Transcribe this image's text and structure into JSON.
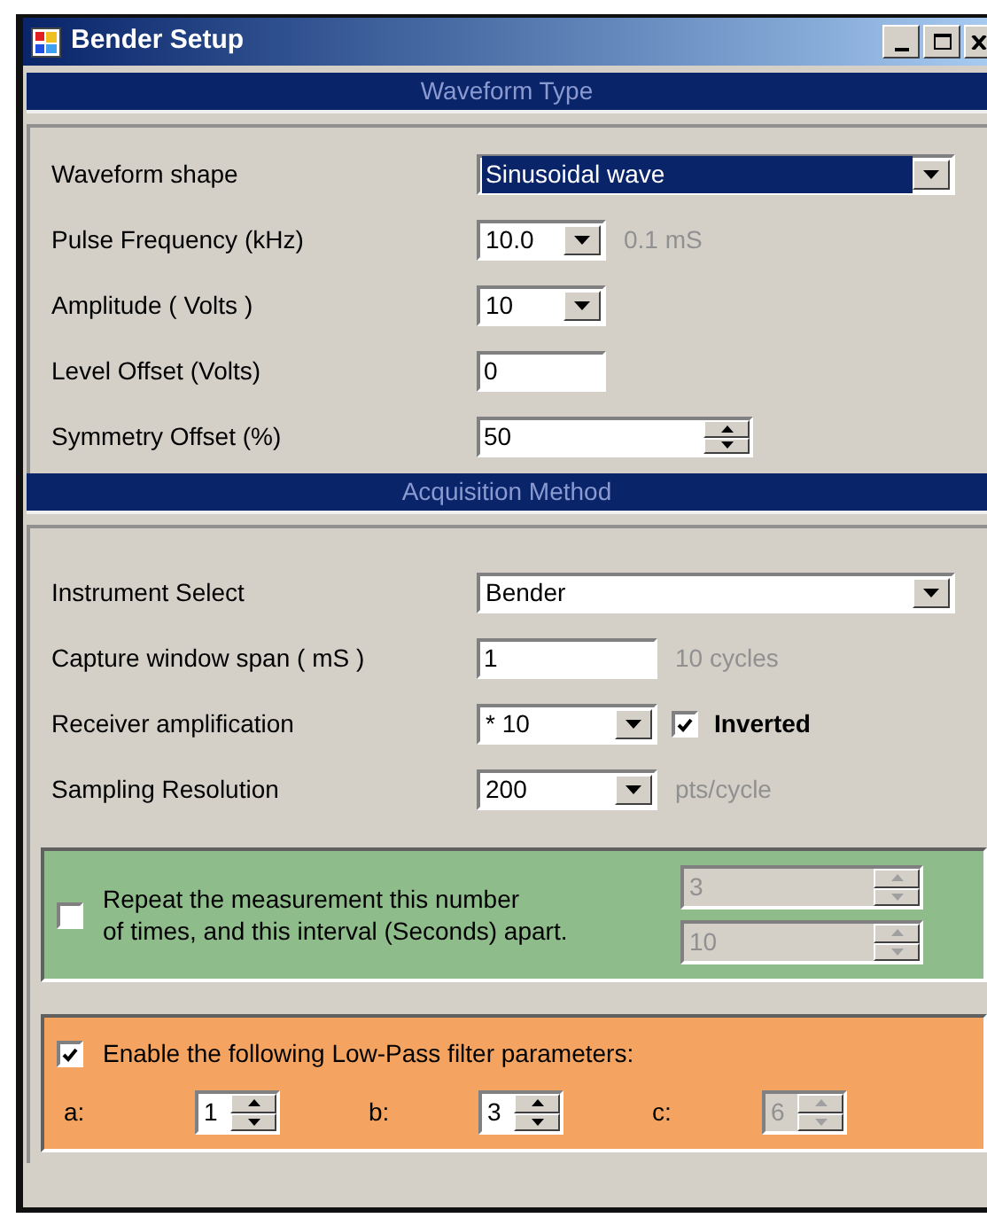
{
  "window": {
    "title": "Bender Setup"
  },
  "sections": [
    {
      "header": "Waveform Type",
      "rows": [
        {
          "label": "Waveform shape",
          "kind": "dropdown",
          "value": "Sinusoidal wave",
          "focused": true
        },
        {
          "label": "Pulse Frequency (kHz)",
          "kind": "dropdown",
          "value": "10.0",
          "focused": false,
          "note": "0.1 mS"
        },
        {
          "label": "Amplitude ( Volts )",
          "kind": "dropdown",
          "value": "10",
          "focused": false
        },
        {
          "label": "Level Offset (Volts)",
          "kind": "textbox",
          "value": "0",
          "focused": false
        },
        {
          "label": "Symmetry Offset (%)",
          "kind": "spinner",
          "value": "50",
          "focused": false
        }
      ]
    },
    {
      "header": "Acquisition Method",
      "rows": [
        {
          "label": "Instrument Select",
          "kind": "dropdown",
          "value": "Bender",
          "focused": false
        },
        {
          "label": "Capture window span ( mS )",
          "kind": "textbox",
          "value": "1",
          "focused": false,
          "note": "10 cycles"
        },
        {
          "label": "Receiver amplification",
          "kind": "dropdown",
          "value": "* 10",
          "focused": false,
          "checkbox": {
            "label": "Inverted",
            "checked": true
          }
        },
        {
          "label": "Sampling Resolution",
          "kind": "dropdown",
          "value": "200",
          "focused": false,
          "note": "pts/cycle"
        }
      ]
    }
  ],
  "repeat_box": {
    "checked": false,
    "text": "Repeat the measurement this number\nof times, and this interval (Seconds) apart.",
    "count": {
      "value": "3",
      "disabled": true
    },
    "interval": {
      "value": "10",
      "disabled": true
    }
  },
  "filter_box": {
    "checked": true,
    "text": "Enable the following Low-Pass filter parameters:",
    "params": [
      {
        "label": "a:",
        "value": "1",
        "disabled": false
      },
      {
        "label": "b:",
        "value": "3",
        "disabled": false
      },
      {
        "label": "c:",
        "value": "6",
        "disabled": true
      }
    ]
  }
}
